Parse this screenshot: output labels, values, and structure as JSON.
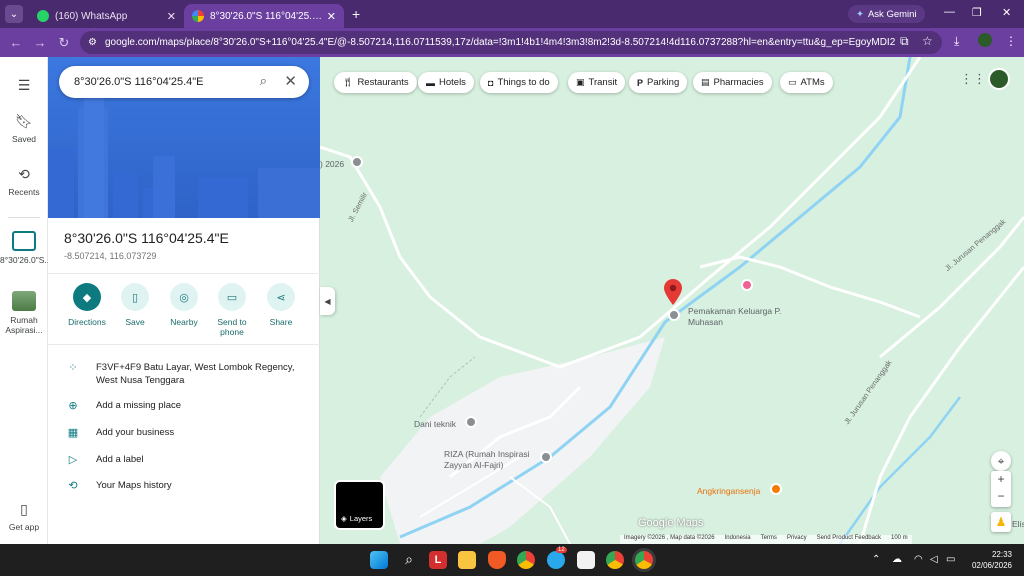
{
  "browser": {
    "tabs": [
      {
        "title": "(160) WhatsApp",
        "active": false
      },
      {
        "title": "8°30'26.0\"S 116°04'25.4\"E - Goo",
        "active": true
      }
    ],
    "ask_gemini": "Ask Gemini",
    "url": "google.com/maps/place/8°30'26.0\"S+116°04'25.4\"E/@-8.507214,116.0711539,17z/data=!3m1!4b1!4m4!3m3!8m2!3d-8.507214!4d116.0737288?hl=en&entry=ttu&g_ep=EgoyMDI2MDUyNy4..."
  },
  "rail": {
    "menu_icon": "hamburger-icon",
    "items": [
      {
        "label": "Saved"
      },
      {
        "label": "Recents"
      },
      {
        "label": "8°30'26.0\"S..."
      },
      {
        "label": "Rumah Aspirasi..."
      },
      {
        "label": "Get app"
      }
    ]
  },
  "search": {
    "value": "8°30'26.0\"S 116°04'25.4\"E"
  },
  "place": {
    "title": "8°30'26.0\"S 116°04'25.4\"E",
    "coords": "-8.507214, 116.073729"
  },
  "actions": [
    {
      "label": "Directions"
    },
    {
      "label": "Save"
    },
    {
      "label": "Nearby"
    },
    {
      "label": "Send to phone"
    },
    {
      "label": "Share"
    }
  ],
  "info_rows": [
    {
      "text": "F3VF+4F9 Batu Layar, West Lombok Regency, West Nusa Tenggara"
    },
    {
      "text": "Add a missing place"
    },
    {
      "text": "Add your business"
    },
    {
      "text": "Add a label"
    },
    {
      "text": "Your Maps history"
    }
  ],
  "chips": [
    {
      "label": "Restaurants"
    },
    {
      "label": "Hotels"
    },
    {
      "label": "Things to do"
    },
    {
      "label": "Transit"
    },
    {
      "label": "Parking"
    },
    {
      "label": "Pharmacies"
    },
    {
      "label": "ATMs"
    }
  ],
  "map": {
    "pois": [
      {
        "name": "Pemakaman Keluarga P. Muhasan"
      },
      {
        "name": "Dani teknik"
      },
      {
        "name": "RIZA (Rumah Inspirasi Zayyan Al-Fajri)"
      },
      {
        "name": "Angkringansenja"
      }
    ],
    "roads": [
      "Jl. Semilir",
      "Jl. Jurusan Penanggak",
      "Jl. Jurusan Penanggak"
    ],
    "edge_labels": [
      ") 2026",
      "Elis"
    ],
    "layers_label": "Layers",
    "logo": "Google Maps",
    "attribution": [
      "Imagery ©2026 , Map data ©2026",
      "Indonesia",
      "Terms",
      "Privacy",
      "Send Product Feedback",
      "100 m"
    ],
    "colors": {
      "land": "#d7f0df",
      "water": "#8fd3f4",
      "road": "#ffffff",
      "pin": "#e53935",
      "poi_pink": "#f06292",
      "poi_orange": "#f57c00"
    }
  },
  "taskbar": {
    "badge_count": "12",
    "time": "22:33",
    "date": "02/06/2026"
  }
}
